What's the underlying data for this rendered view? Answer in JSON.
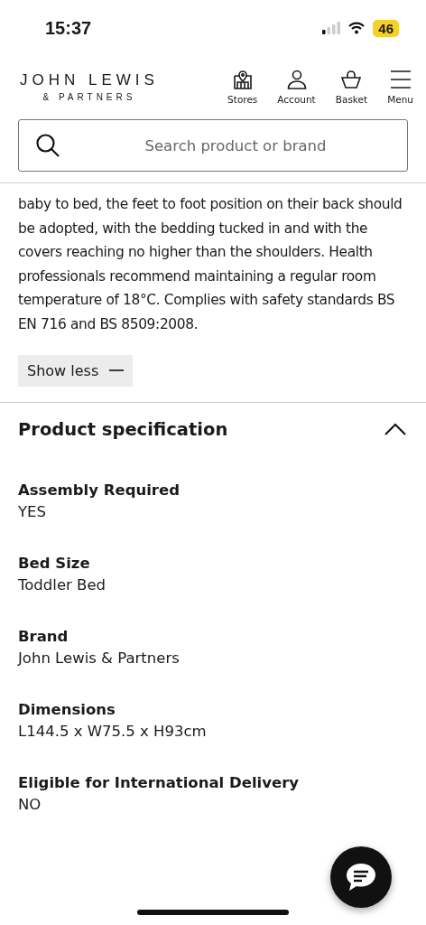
{
  "status_bar": {
    "time": "15:37",
    "battery": "46"
  },
  "header": {
    "logo_main": "JOHN LEWIS",
    "logo_sub": "& PARTNERS",
    "nav": [
      {
        "label": "Stores",
        "kind": "stores"
      },
      {
        "label": "Account",
        "kind": "account"
      },
      {
        "label": "Basket",
        "kind": "basket"
      },
      {
        "label": "Menu",
        "kind": "menu"
      }
    ]
  },
  "search": {
    "placeholder": "Search product or brand"
  },
  "description": {
    "text": "baby to bed, the feet to foot position on their back should be adopted, with the bedding tucked in and with the covers reaching no higher than the shoulders. Health professionals recommend maintaining a regular room temperature of 18°C. Complies with safety standards BS EN 716 and BS 8509:2008.",
    "toggle": "Show less"
  },
  "specification": {
    "title": "Product specification",
    "expanded": true,
    "items": [
      {
        "label": "Assembly Required",
        "value": "YES"
      },
      {
        "label": "Bed Size",
        "value": "Toddler Bed"
      },
      {
        "label": "Brand",
        "value": "John Lewis & Partners"
      },
      {
        "label": "Dimensions",
        "value": "L144.5 x W75.5 x H93cm"
      },
      {
        "label": "Eligible for International Delivery",
        "value": "NO"
      }
    ]
  }
}
